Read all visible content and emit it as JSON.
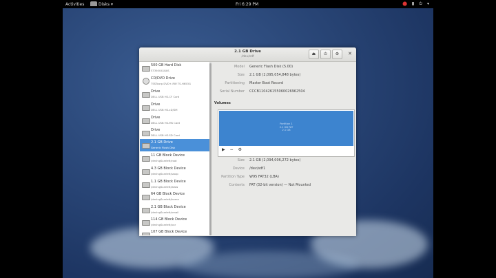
{
  "topbar": {
    "activities": "Activities",
    "app_name": "Disks",
    "app_menu_arrow": "▾",
    "clock": "Fri  6:29 PM",
    "tray": [
      "⬤",
      "▮",
      "⏻",
      "▾"
    ]
  },
  "window": {
    "title": "2.1 GB Drive",
    "subtitle": "/dev/sdf",
    "buttons": {
      "eject": "⏏",
      "power": "⏻",
      "settings": "⚙",
      "close": "✕"
    }
  },
  "devices": [
    {
      "name": "500 GB Hard Disk",
      "detail": "ST3500418AS",
      "icon": "hdd"
    },
    {
      "name": "CD/DVD Drive",
      "detail": "TSSTcorp DVD+-RW TS-H653G",
      "icon": "disc"
    },
    {
      "name": "Drive",
      "detail": "DELL USB   HS-CF Card",
      "icon": "drive"
    },
    {
      "name": "Drive",
      "detail": "DELL USB   HS-xD/SM",
      "icon": "drive"
    },
    {
      "name": "Drive",
      "detail": "DELL USB   HS-MS Card",
      "icon": "drive"
    },
    {
      "name": "Drive",
      "detail": "DELL USB   HS-SD Card",
      "icon": "drive"
    },
    {
      "name": "2.1 GB Drive",
      "detail": "Generic Flash Disk",
      "icon": "usb",
      "selected": true
    },
    {
      "name": "11 GB Block Device",
      "detail": "/devlvgScarlett/root",
      "icon": "block"
    },
    {
      "name": "4.3 GB Block Device",
      "detail": "/devlvgScarlett/swap",
      "icon": "block"
    },
    {
      "name": "1.1 GB Block Device",
      "detail": "/devlvgScarlett/www",
      "icon": "block"
    },
    {
      "name": "64 GB Block Device",
      "detail": "/devlvgScarlett/home",
      "icon": "block"
    },
    {
      "name": "2.1 GB Block Device",
      "detail": "/devlvgScarlett/vmail",
      "icon": "block"
    },
    {
      "name": "114 GB Block Device",
      "detail": "/devlvgScarlett/var",
      "icon": "block"
    },
    {
      "name": "107 GB Block Device",
      "detail": "",
      "icon": "block"
    }
  ],
  "drive_info": {
    "model_label": "Model",
    "model": "Generic Flash Disk (5.00)",
    "size_label": "Size",
    "size": "2.1 GB (2,095,054,848 bytes)",
    "partitioning_label": "Partitioning",
    "partitioning": "Master Boot Record",
    "serial_label": "Serial Number",
    "serial": "CCCB110426155060026962504"
  },
  "volumes": {
    "heading": "Volumes",
    "partition_label": [
      "Partition 1",
      "2.1 GB FAT",
      "2.1 GB"
    ],
    "tools": {
      "play": "▶",
      "minus": "−",
      "gear": "⚙"
    },
    "size_label": "Size",
    "size": "2.1 GB (2,094,006,272 bytes)",
    "device_label": "Device",
    "device": "/dev/sdf1",
    "ptype_label": "Partition Type",
    "ptype": "W95 FAT32 (LBA)",
    "contents_label": "Contents",
    "contents": "FAT (32-bit version) — Not Mounted"
  }
}
